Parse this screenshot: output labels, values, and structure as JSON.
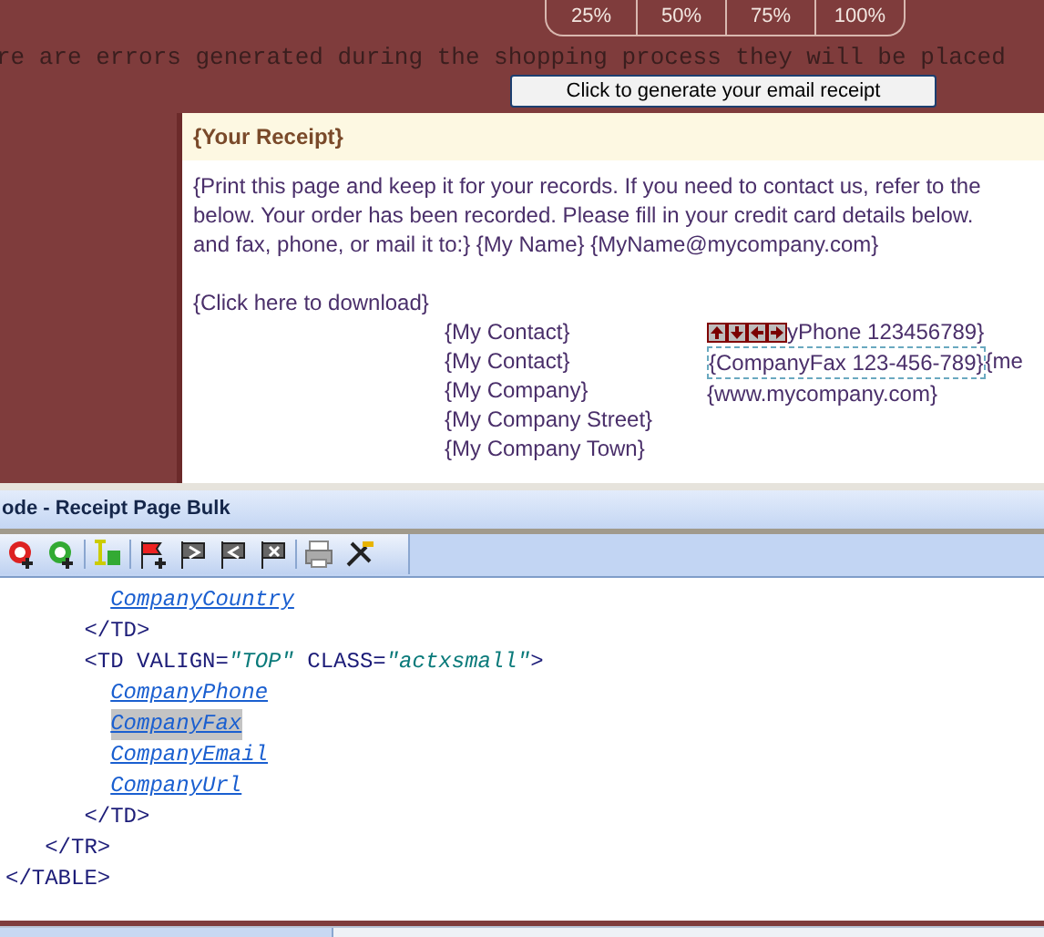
{
  "zoom_options": [
    {
      "label": "25%"
    },
    {
      "label": "50%"
    },
    {
      "label": "75%"
    },
    {
      "label": "100%"
    }
  ],
  "error_message": "re are errors generated during the shopping process they will be placed",
  "generate_button": "Click to generate your email receipt",
  "receipt": {
    "title": "{Your Receipt}",
    "paragraph_lines": [
      "{Print this page and keep it for your records. If you need to contact us, refer to the",
      "below. Your order has been recorded. Please fill in your credit card details below.",
      "and fax, phone, or mail it to:} {My Name} {MyName@mycompany.com}"
    ],
    "download_link": "{Click here to download}",
    "contact_lines": [
      "{My Contact}",
      "{My Contact}",
      "{My Company}",
      "{My Company Street}",
      "{My Company Town}"
    ],
    "phone_partial": "yPhone 123456789}",
    "fax": "{CompanyFax 123-456-789}",
    "email_partial": "{me",
    "url": "{www.mycompany.com}"
  },
  "editor": {
    "title": "ode  - Receipt Page Bulk",
    "code_lines": [
      {
        "kind": "link",
        "text": "        CompanyCountry",
        "selected": false
      },
      {
        "kind": "markup",
        "parts": [
          {
            "kind": "tag",
            "text": "      </TD>"
          }
        ]
      },
      {
        "kind": "markup",
        "parts": [
          {
            "kind": "tag",
            "text": "      <TD VALIGN="
          },
          {
            "kind": "value",
            "text": "\"TOP\""
          },
          {
            "kind": "tag",
            "text": " CLASS="
          },
          {
            "kind": "value",
            "text": "\"actxsmall\""
          },
          {
            "kind": "tag",
            "text": ">"
          }
        ]
      },
      {
        "kind": "link",
        "text": "        CompanyPhone",
        "selected": false
      },
      {
        "kind": "link",
        "text": "        CompanyFax",
        "selected": true
      },
      {
        "kind": "link",
        "text": "        CompanyEmail",
        "selected": false
      },
      {
        "kind": "link",
        "text": "        CompanyUrl",
        "selected": false
      },
      {
        "kind": "markup",
        "parts": [
          {
            "kind": "tag",
            "text": "      </TD>"
          }
        ]
      },
      {
        "kind": "markup",
        "parts": [
          {
            "kind": "tag",
            "text": "   </TR>"
          }
        ]
      },
      {
        "kind": "markup",
        "parts": [
          {
            "kind": "tag",
            "text": "</TABLE>"
          }
        ]
      }
    ]
  }
}
